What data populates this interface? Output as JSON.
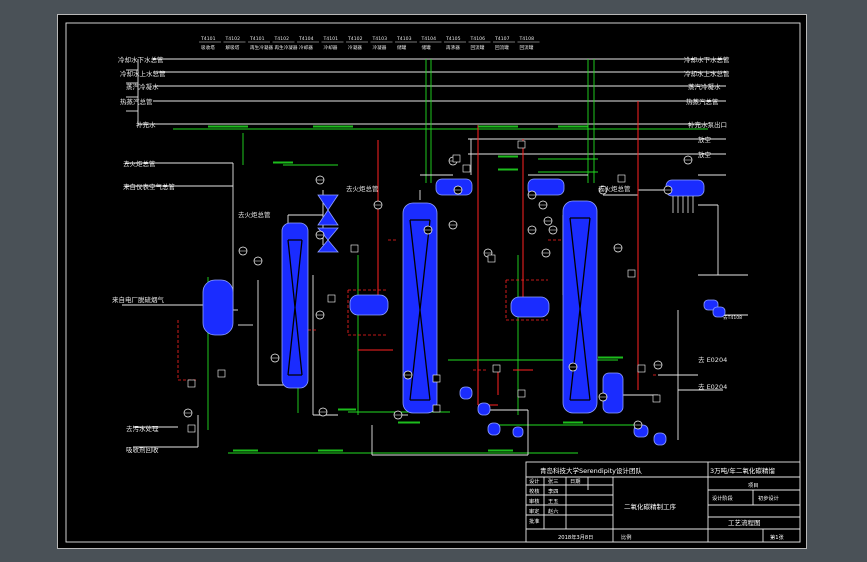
{
  "header_tags": [
    "T4101",
    "T4102",
    "T4101",
    "T4102",
    "T4104",
    "T4101",
    "T4102",
    "T4103",
    "T4103",
    "T4104",
    "T4105",
    "T4106",
    "T4107",
    "T4108"
  ],
  "header_subs": [
    "吸收塔",
    "解吸塔",
    "再生冷凝器",
    "再生冷凝器",
    "冷却器",
    "冷却器",
    "冷凝器",
    "冷凝器",
    "储罐",
    "储罐",
    "再沸器",
    "回流罐",
    "回流罐",
    "回流罐"
  ],
  "left_utilities": [
    "冷却水下水总管",
    "冷却水上水总管",
    "蒸汽冷凝水",
    "热蒸汽总管",
    "补充水"
  ],
  "right_utilities": [
    "冷却水下水总管",
    "冷却水上水总管",
    "蒸汽冷凝水",
    "热蒸汽总管",
    "补充水泵出口",
    "放空",
    "放空"
  ],
  "left_inputs": [
    "去火炬总管",
    "来自仪表空气总管",
    "来自电厂脱硫烟气",
    "去污水处理",
    "吸收剂回收"
  ],
  "to_tags": [
    "去火炬总管",
    "去火炬总管",
    "去火炬总管"
  ],
  "right_outputs": [
    "去 E0204",
    "去 E0204",
    "去T4108"
  ],
  "title_block": {
    "org": "青岛科技大学Serendipity设计团队",
    "project": "3万吨/年二氧化碳精馏",
    "project2": "项目",
    "drawing": "二氧化碳精制工序",
    "drawing_type": "工艺流程图",
    "rows": [
      [
        "设计",
        "张三",
        "日期"
      ],
      [
        "校核",
        "李四",
        ""
      ],
      [
        "审核",
        "王五",
        ""
      ],
      [
        "审定",
        "赵六",
        ""
      ],
      [
        "批准",
        "",
        ""
      ]
    ],
    "phase": "设计阶段",
    "phase_val": "初步设计",
    "date": "2018年3月8日",
    "scale": "比例",
    "sheet": "第1张"
  }
}
